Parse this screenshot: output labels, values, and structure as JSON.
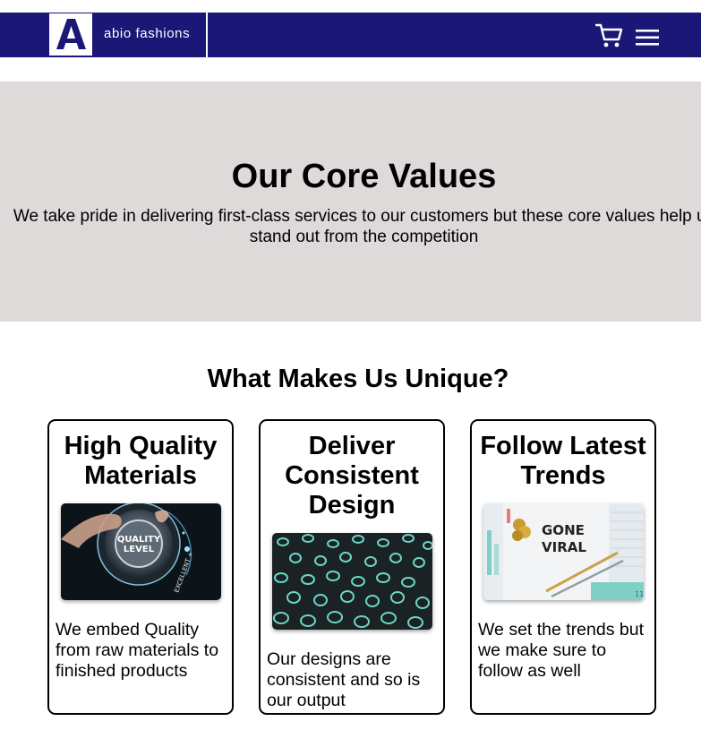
{
  "header": {
    "brand_name": "abio fashions",
    "logo_icon": "abio-a-logo",
    "cart_icon": "cart-icon",
    "menu_icon": "hamburger-menu-icon",
    "bar_color": "#1a1777"
  },
  "hero": {
    "title": "Our Core Values",
    "text": "We take pride in delivering first-class services to our customers but these core values help us stand out from the competition",
    "background": "#dedad9"
  },
  "unique": {
    "title": "What Makes Us Unique?",
    "cards": [
      {
        "title": "High Quality Materials",
        "image": "quality-level-dial",
        "image_text": "QUALITY LEVEL",
        "image_dial_text": "EXCELLENT +",
        "text": "We embed Quality from raw materials to finished products"
      },
      {
        "title": "Deliver Consistent Design",
        "image": "teal-ring-pattern",
        "text": "Our designs are consistent and so is our output"
      },
      {
        "title": "Follow Latest Trends",
        "image": "gone-viral-charts",
        "image_text": "GONE VIRAL",
        "image_page_number": "11",
        "text": "We set the trends but we make sure to follow as well"
      }
    ]
  }
}
